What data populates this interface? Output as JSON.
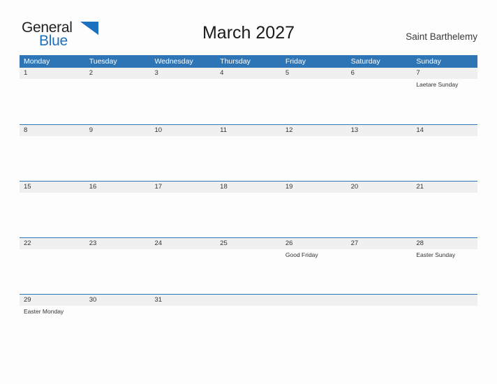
{
  "brand": {
    "name_part1": "General",
    "name_part2": "Blue",
    "flag_icon": "blue-triangle-flag-icon",
    "color_primary": "#1c70bd",
    "color_text": "#231f20"
  },
  "header": {
    "title": "March 2027",
    "location": "Saint Barthelemy"
  },
  "theme": {
    "header_bar_color": "#2e75b6",
    "day_band_color": "#f0f0f0",
    "page_background": "#fdfdfd",
    "text_color": "#333333"
  },
  "calendar": {
    "month": "March",
    "year": "2027",
    "weekdays": [
      "Monday",
      "Tuesday",
      "Wednesday",
      "Thursday",
      "Friday",
      "Saturday",
      "Sunday"
    ],
    "weeks": [
      {
        "days": [
          {
            "number": "1",
            "events": []
          },
          {
            "number": "2",
            "events": []
          },
          {
            "number": "3",
            "events": []
          },
          {
            "number": "4",
            "events": []
          },
          {
            "number": "5",
            "events": []
          },
          {
            "number": "6",
            "events": []
          },
          {
            "number": "7",
            "events": [
              "Laetare Sunday"
            ]
          }
        ]
      },
      {
        "days": [
          {
            "number": "8",
            "events": []
          },
          {
            "number": "9",
            "events": []
          },
          {
            "number": "10",
            "events": []
          },
          {
            "number": "11",
            "events": []
          },
          {
            "number": "12",
            "events": []
          },
          {
            "number": "13",
            "events": []
          },
          {
            "number": "14",
            "events": []
          }
        ]
      },
      {
        "days": [
          {
            "number": "15",
            "events": []
          },
          {
            "number": "16",
            "events": []
          },
          {
            "number": "17",
            "events": []
          },
          {
            "number": "18",
            "events": []
          },
          {
            "number": "19",
            "events": []
          },
          {
            "number": "20",
            "events": []
          },
          {
            "number": "21",
            "events": []
          }
        ]
      },
      {
        "days": [
          {
            "number": "22",
            "events": []
          },
          {
            "number": "23",
            "events": []
          },
          {
            "number": "24",
            "events": []
          },
          {
            "number": "25",
            "events": []
          },
          {
            "number": "26",
            "events": [
              "Good Friday"
            ]
          },
          {
            "number": "27",
            "events": []
          },
          {
            "number": "28",
            "events": [
              "Easter Sunday"
            ]
          }
        ]
      },
      {
        "days": [
          {
            "number": "29",
            "events": [
              "Easter Monday"
            ]
          },
          {
            "number": "30",
            "events": []
          },
          {
            "number": "31",
            "events": []
          },
          {
            "number": "",
            "events": []
          },
          {
            "number": "",
            "events": []
          },
          {
            "number": "",
            "events": []
          },
          {
            "number": "",
            "events": []
          }
        ]
      }
    ]
  }
}
